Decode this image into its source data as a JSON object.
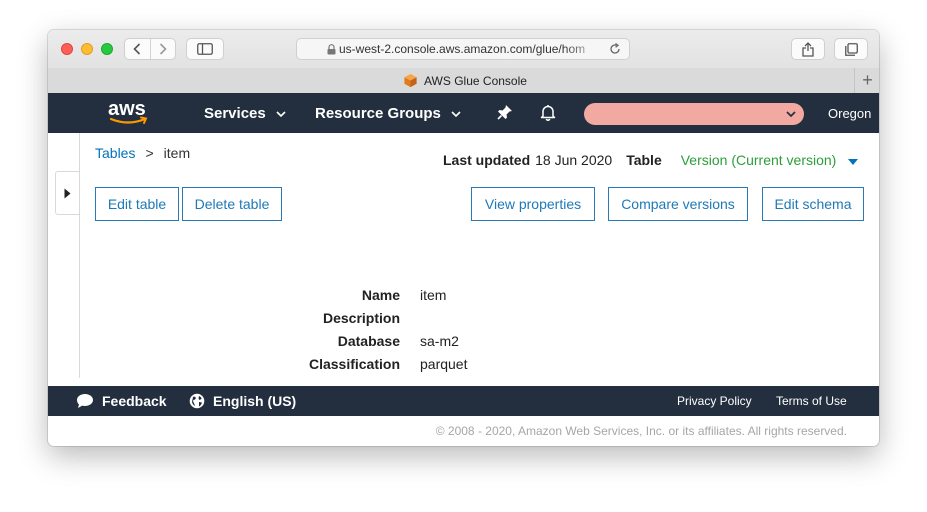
{
  "browser": {
    "url": "us-west-2.console.aws.amazon.com/glue/hom",
    "tab_title": "AWS Glue Console"
  },
  "header": {
    "logo_text": "aws",
    "services_label": "Services",
    "resource_groups_label": "Resource Groups",
    "account_color": "#f2a9a2",
    "region": "Oregon"
  },
  "breadcrumb": {
    "parent": "Tables",
    "separator": ">",
    "current": "item"
  },
  "meta": {
    "last_updated_label": "Last updated",
    "last_updated_value": "18 Jun 2020",
    "table_label": "Table",
    "version_label": "Version (Current version)"
  },
  "actions": {
    "edit_table": "Edit table",
    "delete_table": "Delete table",
    "view_properties": "View properties",
    "compare_versions": "Compare versions",
    "edit_schema": "Edit schema"
  },
  "properties": [
    {
      "label": "Name",
      "value": "item"
    },
    {
      "label": "Description",
      "value": ""
    },
    {
      "label": "Database",
      "value": "sa-m2"
    },
    {
      "label": "Classification",
      "value": "parquet"
    }
  ],
  "footer": {
    "feedback": "Feedback",
    "language": "English (US)",
    "privacy": "Privacy Policy",
    "terms": "Terms of Use",
    "copyright": "© 2008 - 2020, Amazon Web Services, Inc. or its affiliates. All rights reserved."
  },
  "colors": {
    "nav_bg": "#232f3e",
    "link": "#0073bb",
    "version_green": "#2c9e3c",
    "aws_orange": "#ff9900"
  }
}
